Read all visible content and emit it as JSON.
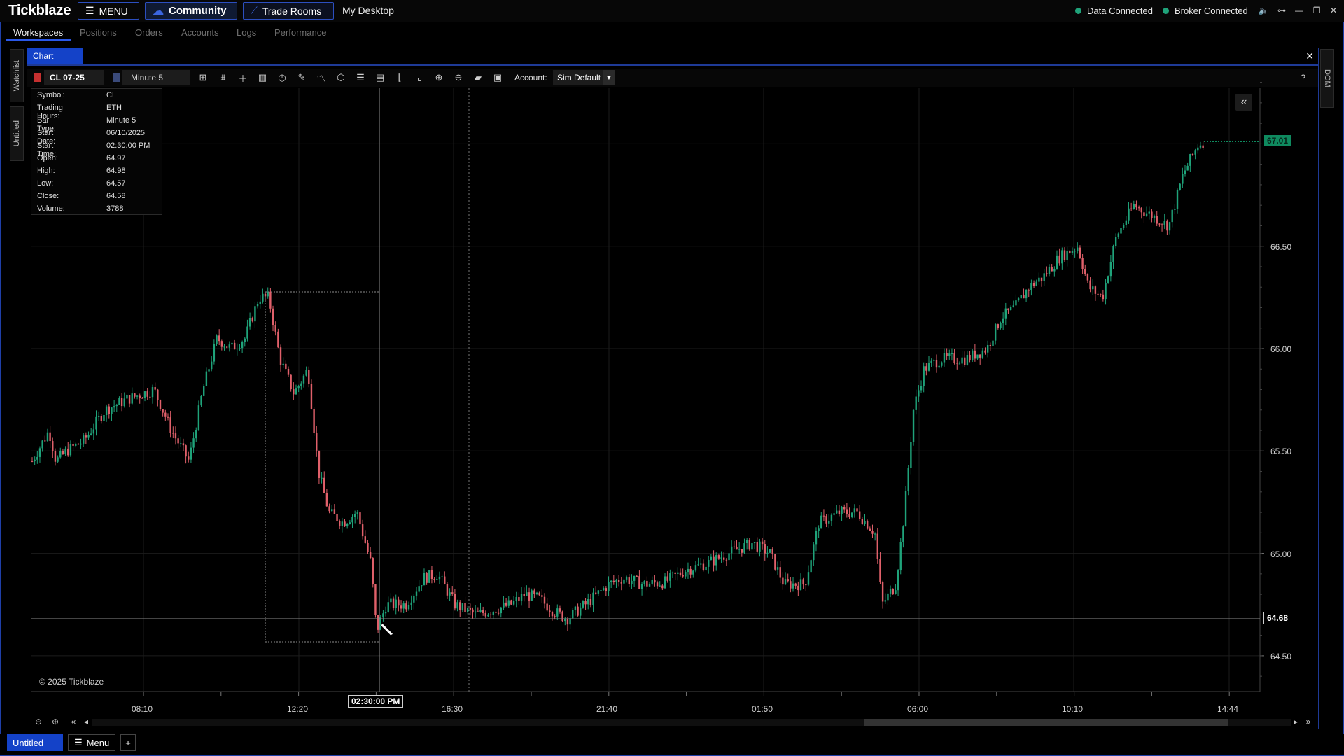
{
  "app": {
    "title": "Tickblaze",
    "menu_label": "MENU",
    "community_label": "Community",
    "trade_rooms_label": "Trade Rooms",
    "desktop_label": "My Desktop",
    "data_status": "Data Connected",
    "broker_status": "Broker Connected",
    "status_color": "#1fa37a"
  },
  "nav": {
    "tabs": [
      "Workspaces",
      "Positions",
      "Orders",
      "Accounts",
      "Logs",
      "Performance"
    ],
    "active": "Workspaces"
  },
  "side": {
    "left_tabs": [
      "Watchlist",
      "Untitled"
    ],
    "right_tab": "DOM"
  },
  "chart_window": {
    "tab_label": "Chart",
    "symbol": "CL 07-25",
    "bar_type": "Minute 5",
    "account_label": "Account:",
    "account_value": "Sim Default",
    "help": "?",
    "copyright": "© 2025 Tickblaze"
  },
  "data_box": [
    {
      "k": "Symbol:",
      "v": "CL"
    },
    {
      "k": "Trading Hours:",
      "v": "ETH"
    },
    {
      "k": "Bar Type:",
      "v": "Minute 5"
    },
    {
      "k": "Start Date:",
      "v": "06/10/2025"
    },
    {
      "k": "Start Time:",
      "v": "02:30:00 PM"
    },
    {
      "k": "Open:",
      "v": "64.97"
    },
    {
      "k": "High:",
      "v": "64.98"
    },
    {
      "k": "Low:",
      "v": "64.57"
    },
    {
      "k": "Close:",
      "v": "64.58"
    },
    {
      "k": "Volume:",
      "v": "3788"
    }
  ],
  "axes": {
    "price_ticks": [
      "66.50",
      "66.00",
      "65.50",
      "65.00",
      "64.50"
    ],
    "last_price": "67.01",
    "crosshair_price": "64.68",
    "time_ticks": [
      "08:10",
      "12:20",
      "16:30",
      "21:40",
      "01:50",
      "06:00",
      "10:10",
      "14:44"
    ],
    "crosshair_time": "02:30:00 PM"
  },
  "bottom": {
    "workspace_tab": "Untitled",
    "menu_label": "Menu",
    "add_label": "+"
  },
  "colors": {
    "up": "#1fa37a",
    "down": "#e0606a",
    "accent": "#1442c8"
  }
}
